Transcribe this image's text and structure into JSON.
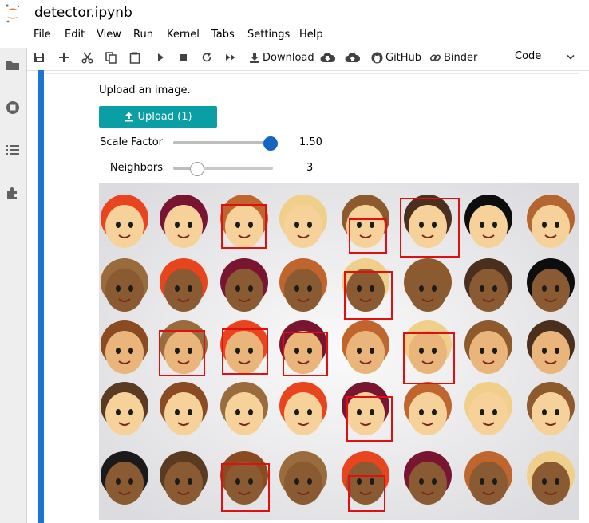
{
  "window": {
    "title": "detector.ipynb"
  },
  "menu": [
    "File",
    "Edit",
    "View",
    "Run",
    "Kernel",
    "Tabs",
    "Settings",
    "Help"
  ],
  "toolbar": {
    "download_label": "Download",
    "github_label": "GitHub",
    "binder_label": "Binder",
    "cell_type": "Code"
  },
  "cell": {
    "prompt": "Upload an image.",
    "upload_label": "Upload (1)",
    "scale_factor": {
      "label": "Scale Factor",
      "value": 1.5,
      "display": "1.50",
      "fraction": 0.97
    },
    "neighbors": {
      "label": "Neighbors",
      "value": 3,
      "display": "3",
      "fraction": 0.23
    }
  },
  "colors": {
    "accent": "#1976d2",
    "upload_button": "#0a9ea5",
    "slider_handle": "#1565c0",
    "detection_box": "#e01010"
  },
  "icons": [
    "jupyter-logo-icon",
    "folder-icon",
    "running-icon",
    "commands-icon",
    "extensions-icon",
    "save-icon",
    "add-cell-icon",
    "cut-icon",
    "copy-icon",
    "paste-icon",
    "run-icon",
    "stop-icon",
    "restart-icon",
    "fast-forward-icon",
    "download-icon",
    "cloud-download-icon",
    "cloud-upload-icon",
    "github-icon",
    "binder-icon",
    "chevron-down-icon",
    "upload-icon"
  ]
}
